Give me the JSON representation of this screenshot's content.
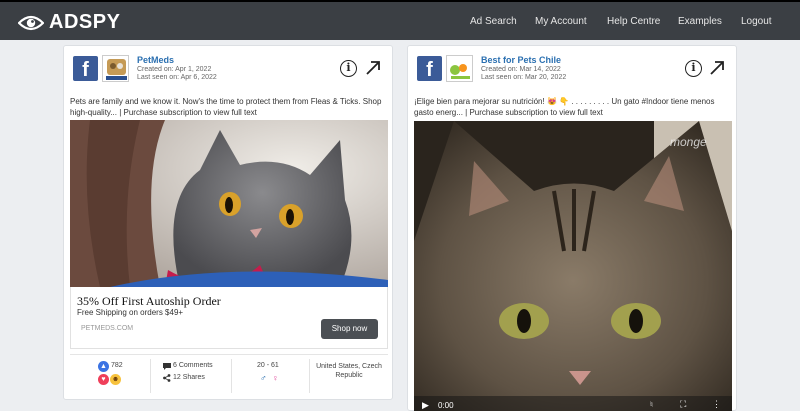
{
  "header": {
    "logo_text": "ADSPY",
    "nav": [
      "Ad Search",
      "My Account",
      "Help Centre",
      "Examples",
      "Logout"
    ]
  },
  "ads": [
    {
      "page_name": "PetMeds",
      "created": "Created on: Apr 1, 2022",
      "last_seen": "Last seen on: Apr 6, 2022",
      "text": "Pets are family and we know it. Now's the time to protect them from Fleas & Ticks. Shop high-quality... | Purchase subscription to view full text",
      "headline": "35% Off First Autoship Order",
      "subline": "Free Shipping on orders $49+",
      "domain": "PETMEDS.COM",
      "cta": "Shop now",
      "likes": "782",
      "comments": "6 Comments",
      "shares": "12 Shares",
      "age_range": "20 - 61",
      "countries": "United States, Czech Republic"
    },
    {
      "page_name": "Best for Pets Chile",
      "created": "Created on: Mar 14, 2022",
      "last_seen": "Last seen on: Mar 20, 2022",
      "text": "¡Elige bien para mejorar su nutrición! 😻 👇 . . . . . . . . . Un gato #Indoor tiene menos gasto energ... | Purchase subscription to view full text",
      "video_watermark": "monge",
      "video_time": "0:00"
    }
  ],
  "colors": {
    "navbar": "#3b3f44",
    "facebook_blue": "#3b5b98",
    "link_blue": "#2a6fb0",
    "button_dark": "#4b4f54"
  },
  "icons": [
    "eye-logo-icon",
    "facebook-icon",
    "info-icon",
    "external-link-icon",
    "like-icon",
    "love-icon",
    "haha-icon",
    "comment-icon",
    "share-icon",
    "male-icon",
    "female-icon",
    "play-icon",
    "volume-icon",
    "fullscreen-icon",
    "more-icon"
  ]
}
